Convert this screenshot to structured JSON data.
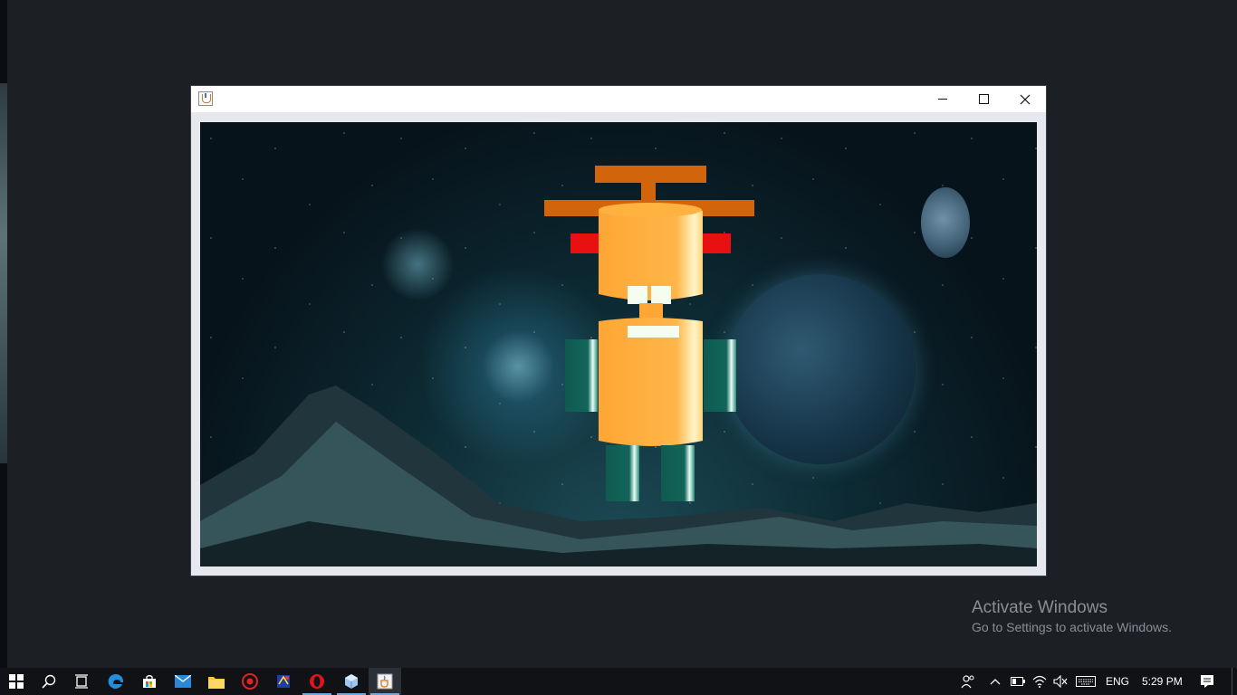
{
  "window": {
    "title": "",
    "controls": {
      "minimize": "minimize",
      "maximize": "maximize",
      "close": "close"
    },
    "icon": "java-coffee-cup-icon"
  },
  "scene": {
    "subject": "robot",
    "colors": {
      "body": "#ffac3b",
      "propeller": "#d2650b",
      "ears": "#e81010",
      "arms_legs": "#126257",
      "highlight": "#f4fdf0"
    }
  },
  "watermark": {
    "title": "Activate Windows",
    "subtitle": "Go to Settings to activate Windows."
  },
  "taskbar": {
    "apps": [
      {
        "name": "start",
        "icon": "windows-logo-icon"
      },
      {
        "name": "search",
        "icon": "search-icon"
      },
      {
        "name": "task-view",
        "icon": "task-view-icon"
      },
      {
        "name": "edge",
        "icon": "edge-icon"
      },
      {
        "name": "store",
        "icon": "store-icon"
      },
      {
        "name": "mail",
        "icon": "mail-icon"
      },
      {
        "name": "file-explorer",
        "icon": "folder-icon"
      },
      {
        "name": "app-red-circle",
        "icon": "red-circle-app-icon"
      },
      {
        "name": "app-blue",
        "icon": "blue-app-icon"
      },
      {
        "name": "opera",
        "icon": "opera-icon"
      },
      {
        "name": "app-cube",
        "icon": "cube-app-icon"
      },
      {
        "name": "java",
        "icon": "java-app-icon"
      }
    ],
    "tray": {
      "language": "ENG",
      "time": "5:29 PM",
      "icons": [
        "people-icon",
        "chevron-up-icon",
        "battery-icon",
        "wifi-icon",
        "speaker-muted-icon",
        "keyboard-icon",
        "notification-icon"
      ]
    }
  }
}
